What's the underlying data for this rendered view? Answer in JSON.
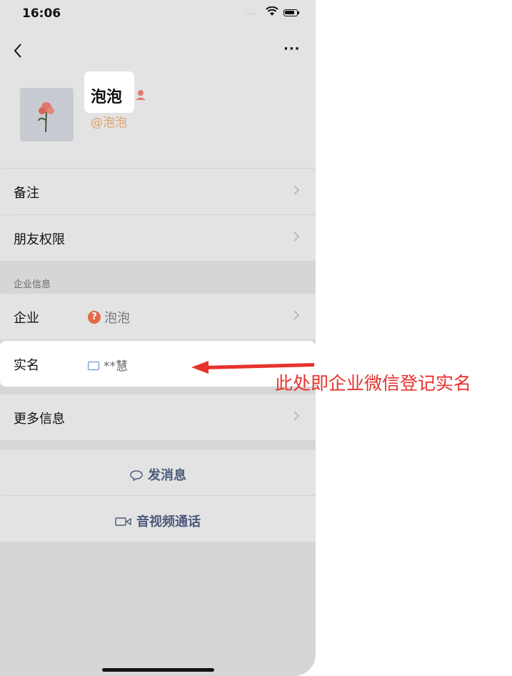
{
  "status_bar": {
    "time": "16:06",
    "signal": "....."
  },
  "profile": {
    "name": "泡泡",
    "corp_name": "@泡泡"
  },
  "rows": {
    "remark": "备注",
    "friend_permissions": "朋友权限",
    "section_title": "企业信息",
    "corp_label": "企业",
    "corp_value": "泡泡",
    "real_name_label": "实名",
    "real_name_value": "**慧",
    "more_info": "更多信息"
  },
  "actions": {
    "send_message": "发消息",
    "video_call": "音视频通话"
  },
  "annotation": {
    "text": "此处即企业微信登记实名",
    "color": "#e8322c"
  },
  "colors": {
    "accent": "#4d5a7c",
    "corp_orange": "#e0a060",
    "question_icon": "#e06a4a"
  }
}
